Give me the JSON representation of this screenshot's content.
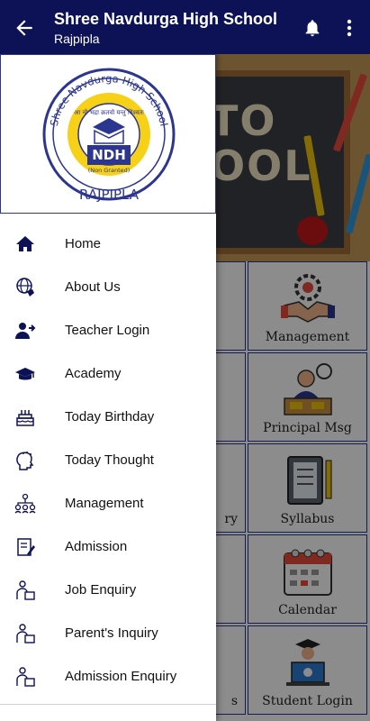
{
  "appbar": {
    "title": "Shree Navdurga High School",
    "subtitle": "Rajpipla",
    "back_icon": "arrow-back-icon",
    "bell_icon": "bell-icon",
    "more_icon": "more-vertical-icon"
  },
  "colors": {
    "primary": "#0d1257",
    "grid_border": "#2c3690",
    "logo_blue": "#2c3690",
    "logo_yellow": "#f7d117"
  },
  "logo": {
    "top_text": "Shree Navdurga High School",
    "motto": "आ नो भद्रा क्रतवो यन्तु विश्वतः",
    "initials": "NDH",
    "tag": "(Non Granted)",
    "bottom_text": "RAJPIPLA"
  },
  "banner": {
    "board_text_top": "TO",
    "board_text_bottom": "OOL"
  },
  "menu": [
    {
      "label": "Home",
      "icon": "home-icon"
    },
    {
      "label": "About Us",
      "icon": "globe-hand-icon"
    },
    {
      "label": "Teacher Login",
      "icon": "user-login-icon"
    },
    {
      "label": "Academy",
      "icon": "graduation-cap-icon"
    },
    {
      "label": "Today Birthday",
      "icon": "birthday-cake-icon"
    },
    {
      "label": "Today Thought",
      "icon": "thought-head-icon"
    },
    {
      "label": "Management",
      "icon": "organization-icon"
    },
    {
      "label": "Admission",
      "icon": "admission-form-icon"
    },
    {
      "label": "Job Enquiry",
      "icon": "person-desk-icon"
    },
    {
      "label": "Parent's Inquiry",
      "icon": "person-desk-icon"
    },
    {
      "label": "Admission Enquiry",
      "icon": "person-desk-icon"
    }
  ],
  "grid": {
    "right_column": [
      {
        "label": "Management",
        "icon": "handshake-gear-icon"
      },
      {
        "label": "Principal Msg",
        "icon": "principal-desk-icon"
      },
      {
        "label": "Syllabus",
        "icon": "notebook-pencil-icon"
      },
      {
        "label": "Calendar",
        "icon": "calendar-icon"
      },
      {
        "label": "Student Login",
        "icon": "student-laptop-icon"
      }
    ],
    "middle_column_partial": [
      {
        "label": ""
      },
      {
        "label": ""
      },
      {
        "label": "ry"
      },
      {
        "label": ""
      },
      {
        "label": "s"
      }
    ]
  }
}
